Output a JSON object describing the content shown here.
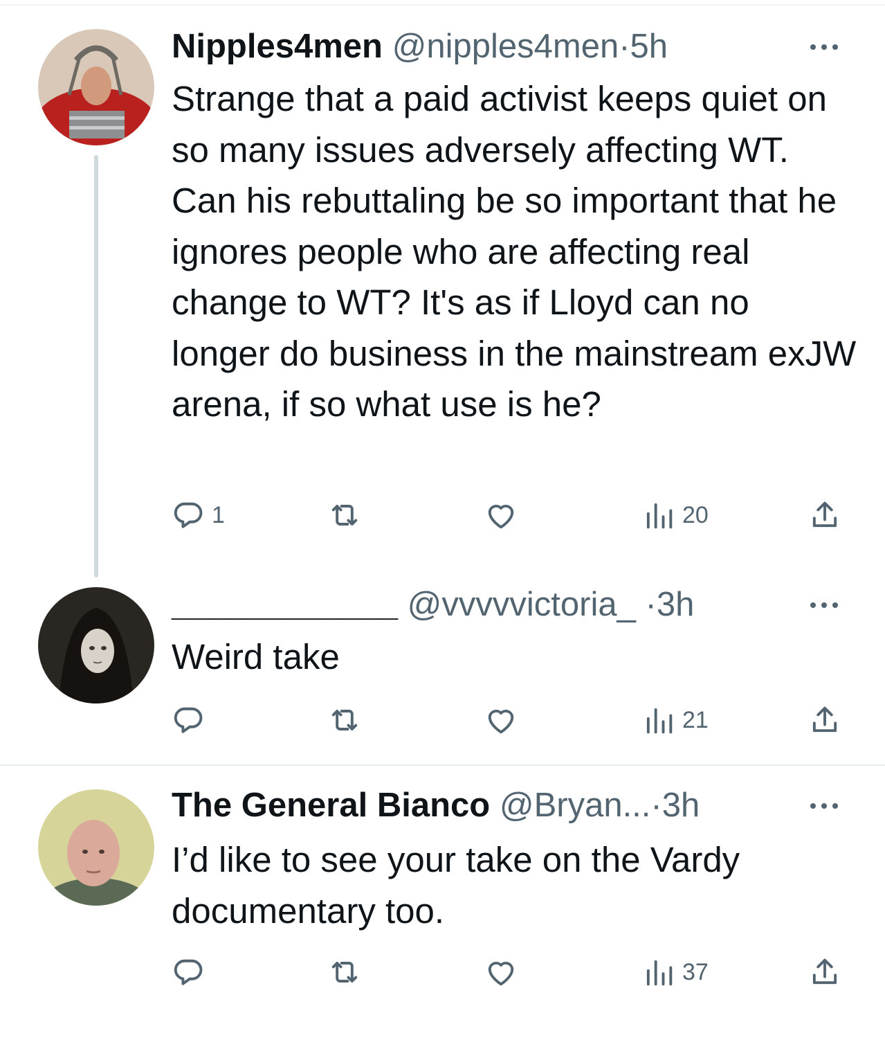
{
  "tweets": [
    {
      "name": "Nipples4men",
      "handle": "@nipples4men",
      "separator": "·",
      "time": "5h",
      "text": "Strange that a paid activist keeps quiet on so many issues adversely affecting WT. Can his rebuttaling be so important that he ignores people who are affecting real change to WT? It's as if Lloyd can no longer do business in the mainstream exJW arena, if so what use is he?",
      "replies": "1",
      "views": "20"
    },
    {
      "name": "____________",
      "handle": "@vvvvvictoria_",
      "separator": "·",
      "time": "3h",
      "text": "Weird take",
      "replies": "",
      "views": "21"
    },
    {
      "name": "The General Bianco",
      "handle": "@Bryan...",
      "separator": "·",
      "time": "3h",
      "text": "I’d like to see your take on the Vardy documentary too.",
      "replies": "",
      "views": "37"
    }
  ],
  "icons": {
    "reply": "reply-icon",
    "retweet": "retweet-icon",
    "like": "heart-icon",
    "views": "views-icon",
    "share": "share-icon",
    "more": "more-icon"
  },
  "colors": {
    "text": "#0f1419",
    "muted": "#536471",
    "thread_line": "#cfd9de"
  }
}
